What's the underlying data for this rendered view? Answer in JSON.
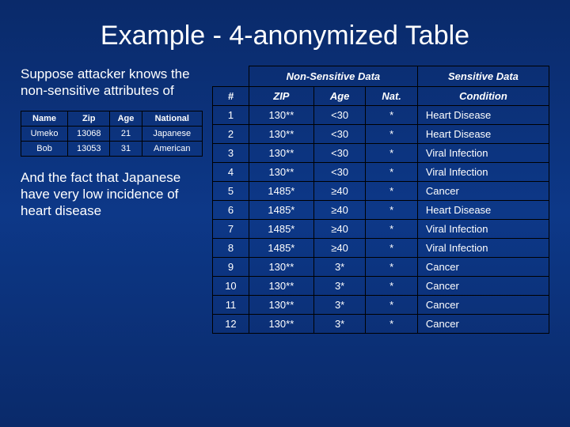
{
  "title": "Example - 4-anonymized Table",
  "left": {
    "para1": "Suppose attacker knows the non-sensitive attributes of",
    "para2": "And the fact that Japanese have very low incidence of heart disease",
    "attacker_table": {
      "headers": {
        "name": "Name",
        "zip": "Zip",
        "age": "Age",
        "nat": "National"
      },
      "rows": [
        {
          "name": "Umeko",
          "zip": "13068",
          "age": "21",
          "nat": "Japanese"
        },
        {
          "name": "Bob",
          "zip": "13053",
          "age": "31",
          "nat": "American"
        }
      ]
    }
  },
  "main": {
    "group_headers": {
      "nonsensitive": "Non-Sensitive Data",
      "sensitive": "Sensitive Data"
    },
    "col_headers": {
      "num": "#",
      "zip": "ZIP",
      "age": "Age",
      "nat": "Nat.",
      "cond": "Condition"
    },
    "rows": [
      {
        "num": "1",
        "zip": "130**",
        "age": "<30",
        "nat": "*",
        "cond": "Heart Disease"
      },
      {
        "num": "2",
        "zip": "130**",
        "age": "<30",
        "nat": "*",
        "cond": "Heart Disease"
      },
      {
        "num": "3",
        "zip": "130**",
        "age": "<30",
        "nat": "*",
        "cond": "Viral Infection"
      },
      {
        "num": "4",
        "zip": "130**",
        "age": "<30",
        "nat": "*",
        "cond": "Viral Infection"
      },
      {
        "num": "5",
        "zip": "1485*",
        "age": "≥40",
        "nat": "*",
        "cond": "Cancer"
      },
      {
        "num": "6",
        "zip": "1485*",
        "age": "≥40",
        "nat": "*",
        "cond": "Heart Disease"
      },
      {
        "num": "7",
        "zip": "1485*",
        "age": "≥40",
        "nat": "*",
        "cond": "Viral Infection"
      },
      {
        "num": "8",
        "zip": "1485*",
        "age": "≥40",
        "nat": "*",
        "cond": "Viral Infection"
      },
      {
        "num": "9",
        "zip": "130**",
        "age": "3*",
        "nat": "*",
        "cond": "Cancer"
      },
      {
        "num": "10",
        "zip": "130**",
        "age": "3*",
        "nat": "*",
        "cond": "Cancer"
      },
      {
        "num": "11",
        "zip": "130**",
        "age": "3*",
        "nat": "*",
        "cond": "Cancer"
      },
      {
        "num": "12",
        "zip": "130**",
        "age": "3*",
        "nat": "*",
        "cond": "Cancer"
      }
    ]
  }
}
